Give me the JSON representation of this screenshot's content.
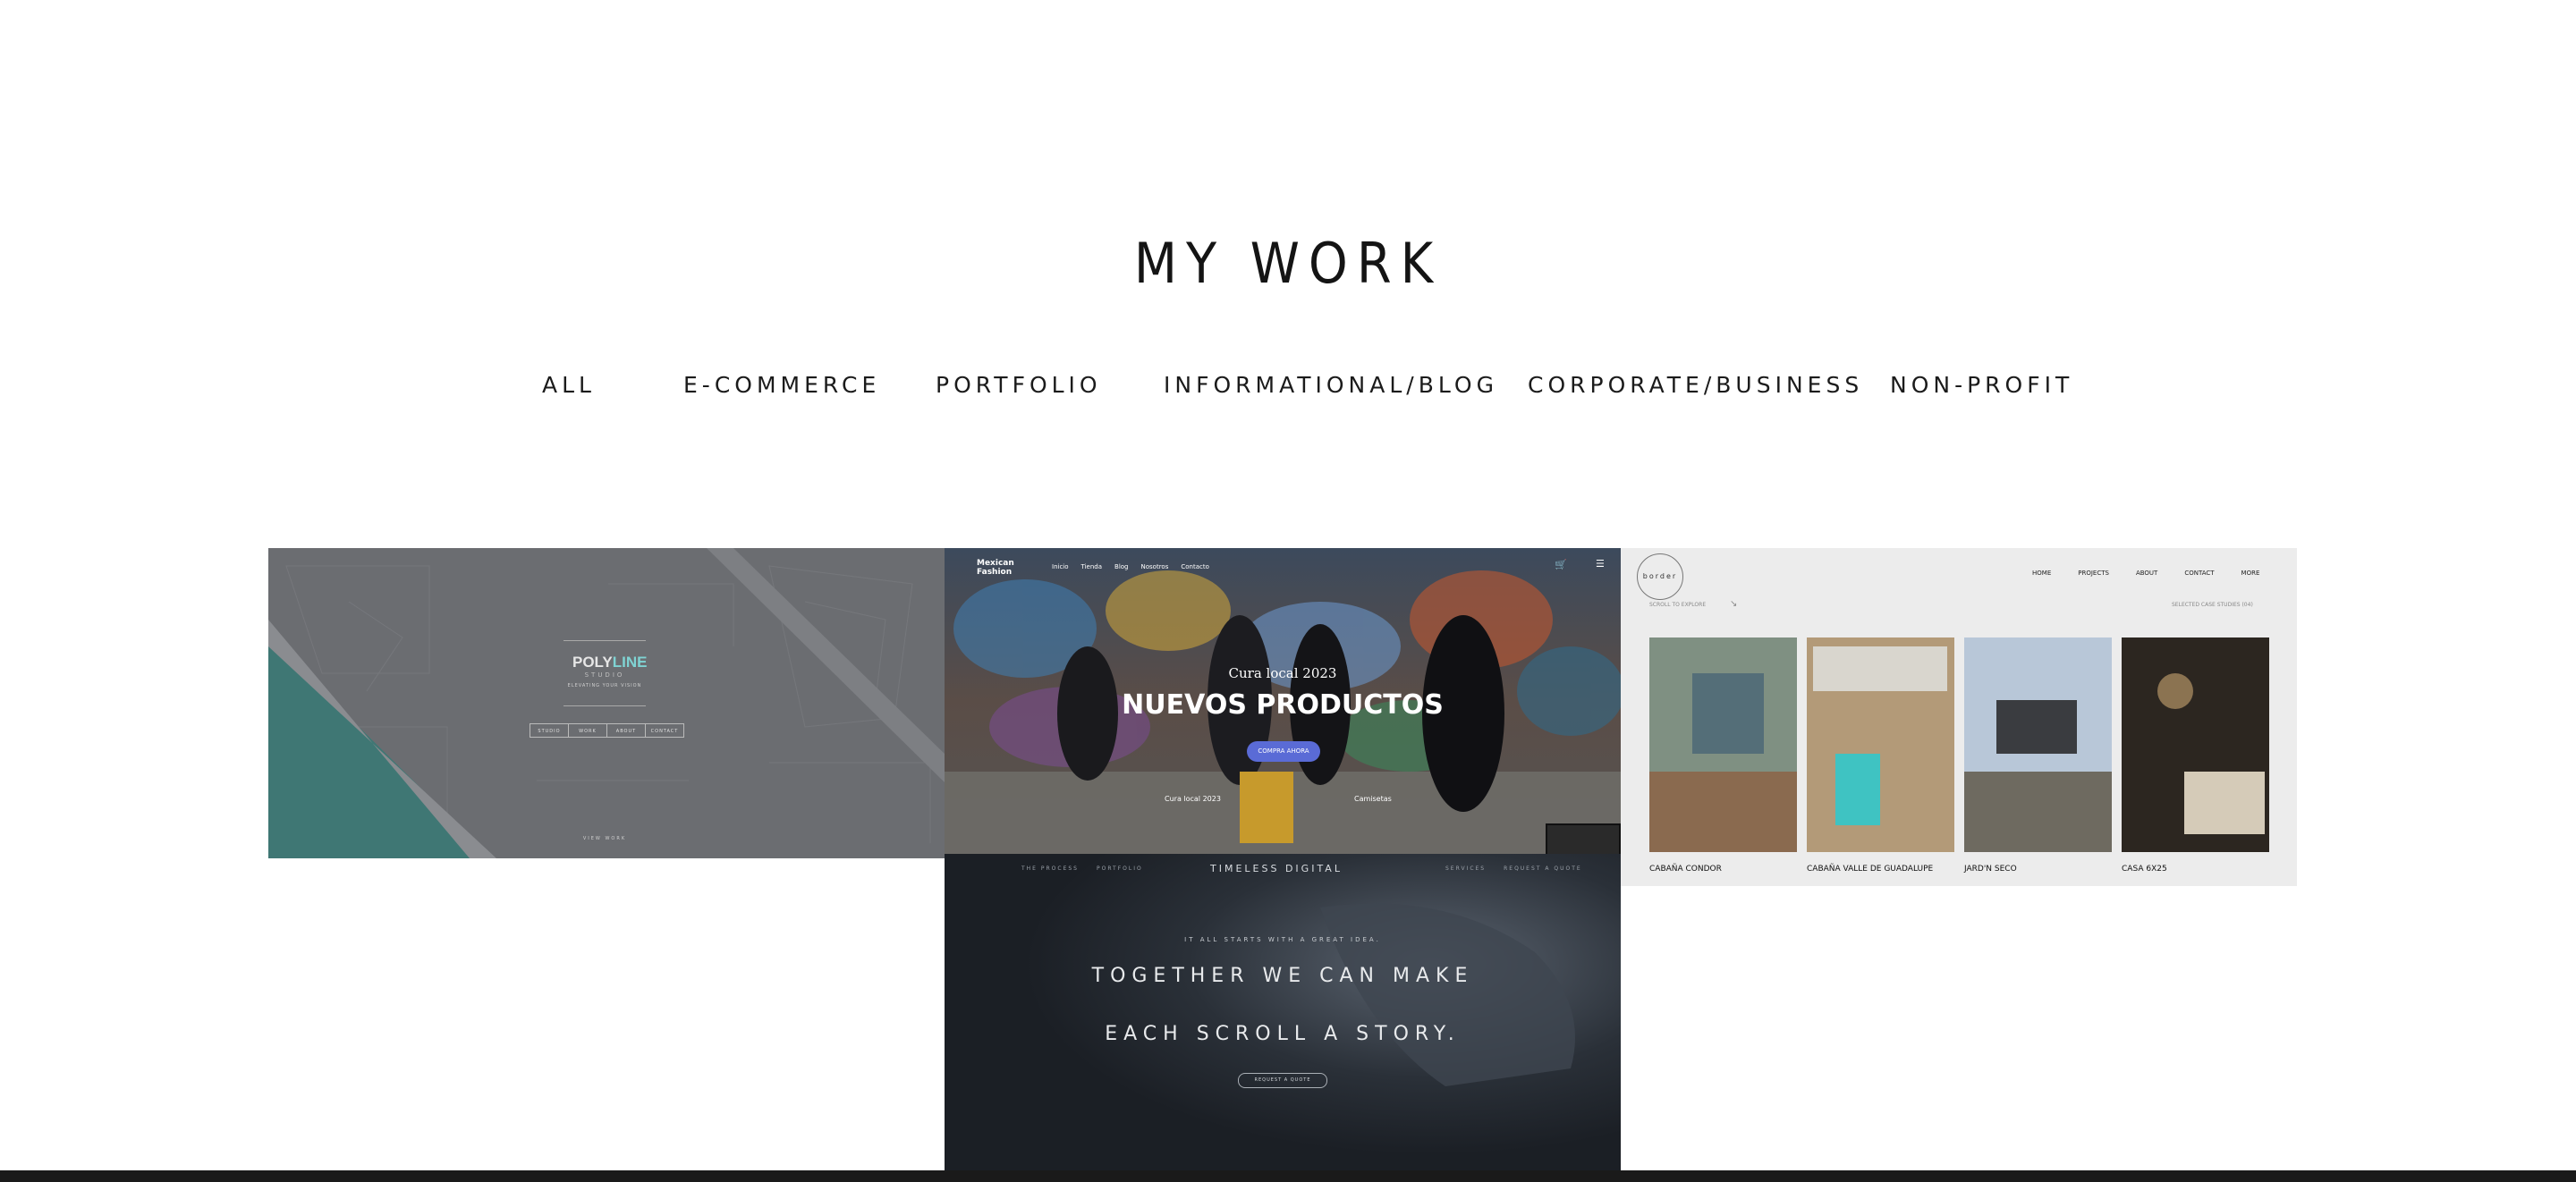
{
  "section_title": "MY WORK",
  "filters": [
    "ALL",
    "E-COMMERCE",
    "PORTFOLIO",
    "INFORMATIONAL/BLOG",
    "CORPORATE/BUSINESS",
    "NON-PROFIT"
  ],
  "polyline": {
    "logo_a": "POLY",
    "logo_b": "LINE",
    "logo_sub": "STUDIO",
    "tagline": "ELEVATING YOUR VISION",
    "nav": [
      "STUDIO",
      "WORK",
      "ABOUT",
      "CONTACT"
    ],
    "footer": "VIEW WORK"
  },
  "mexican": {
    "logo": "Mexican Fashion",
    "nav": [
      "Inicio",
      "Tienda",
      "Blog",
      "Nosotros",
      "Contacto"
    ],
    "kicker": "Cura local 2023",
    "headline": "NUEVOS PRODUCTOS",
    "cta": "COMPRA AHORA",
    "bottom_left": "Cura local 2023",
    "bottom_right": "Camisetas"
  },
  "border": {
    "logo": "border",
    "nav": [
      "HOME",
      "PROJECTS",
      "ABOUT",
      "CONTACT",
      "MORE"
    ],
    "scroll_hint": "SCROLL TO EXPLORE",
    "selected": "SELECTED CASE STUDIES (04)",
    "projects": [
      "CABAÑA CONDOR",
      "CABAÑA VALLE DE GUADALUPE",
      "JARD'N SECO",
      "CASA 6X25"
    ]
  },
  "timeless": {
    "nav_left": [
      "THE PROCESS",
      "PORTFOLIO"
    ],
    "brand": "TIMELESS DIGITAL",
    "nav_right": [
      "SERVICES",
      "REQUEST A QUOTE"
    ],
    "kicker": "IT ALL STARTS WITH A GREAT IDEA.",
    "line1": "TOGETHER WE CAN MAKE",
    "line2": "EACH SCROLL A STORY.",
    "cta": "REQUEST A QUOTE"
  }
}
